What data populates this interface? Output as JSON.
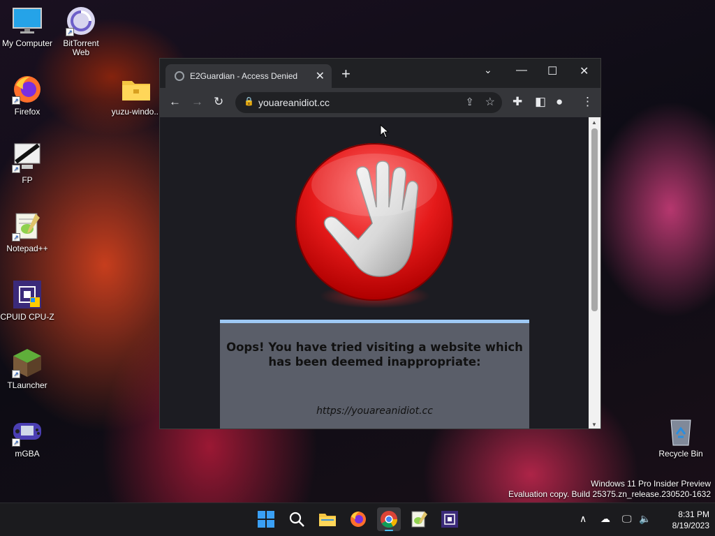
{
  "desktop": {
    "icons": [
      {
        "label": "My Computer"
      },
      {
        "label": "BitTorrent Web"
      },
      {
        "label": "Firefox"
      },
      {
        "label": "yuzu-windo..."
      },
      {
        "label": "FP"
      },
      {
        "label": "Notepad++"
      },
      {
        "label": "CPUID CPU-Z"
      },
      {
        "label": "TLauncher"
      },
      {
        "label": "mGBA"
      },
      {
        "label": "Recycle Bin"
      }
    ],
    "watermark": {
      "line1": "Windows 11 Pro Insider Preview",
      "line2": "Evaluation copy. Build 25375.zn_release.230520-1632"
    }
  },
  "browser": {
    "tab_title": "E2Guardian - Access Denied",
    "address": "youareanidiot.cc",
    "page": {
      "heading": "Oops! You have tried visiting a website which has been deemed inappropriate:",
      "blocked_url": "https://youareanidiot.cc"
    }
  },
  "taskbar": {
    "time": "8:31 PM",
    "date": "8/19/2023",
    "pinned": [
      "Start",
      "Search",
      "File Explorer",
      "Firefox",
      "Google Chrome",
      "Notepad++",
      "CPUID CPU-Z"
    ],
    "active_app": "Google Chrome"
  },
  "colors": {
    "stop_red": "#e51a1a",
    "message_box_bg": "#5a5e69",
    "message_box_border": "#9ec9f5",
    "browser_chrome": "#35363a",
    "taskbar_bg": "#1b1b1e"
  }
}
